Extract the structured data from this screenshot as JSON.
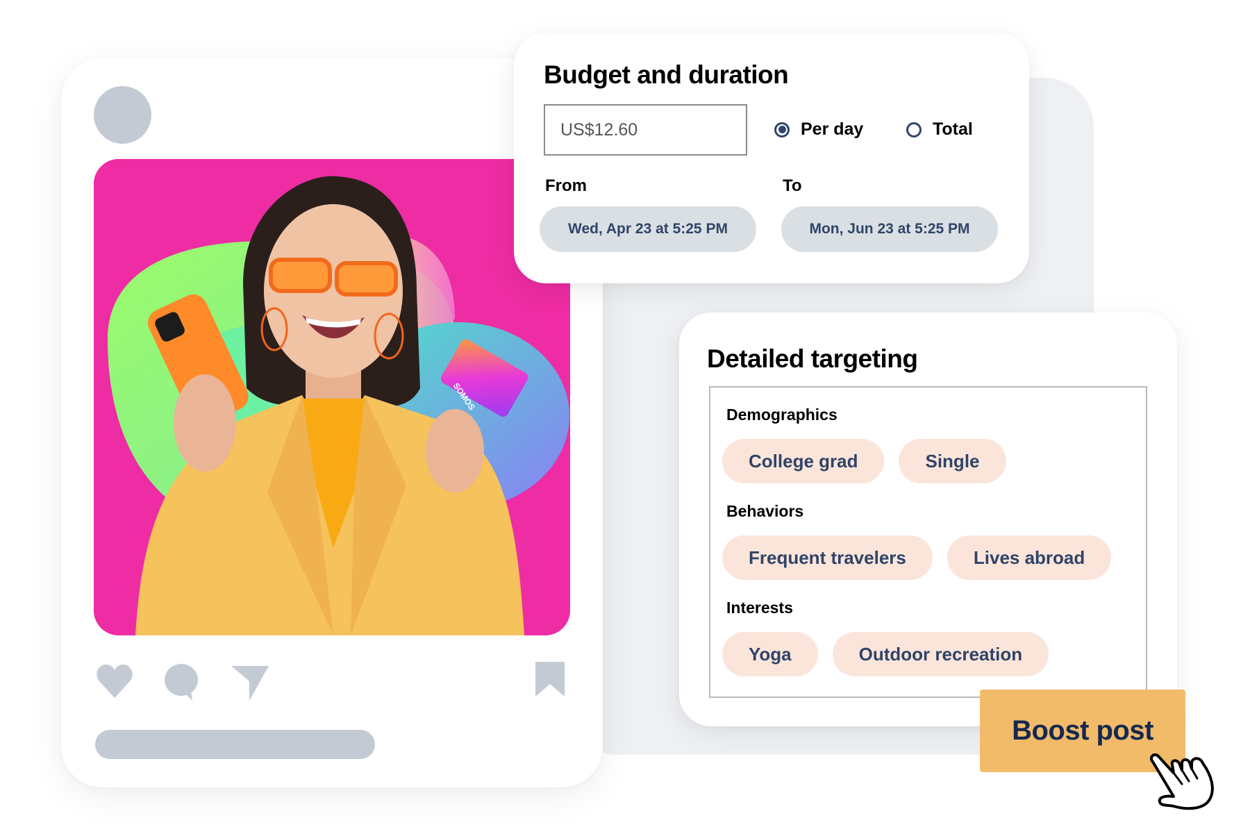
{
  "post": {
    "image_alt": "Smiling woman in orange sunglasses and yellow jacket holding an orange phone and a payment card on a pink background with gradient blobs",
    "card_brand_text": "SOMOS",
    "actions": [
      {
        "name": "like",
        "icon": "heart-icon"
      },
      {
        "name": "comment",
        "icon": "comment-bubble-icon"
      },
      {
        "name": "share",
        "icon": "send-icon"
      },
      {
        "name": "save",
        "icon": "bookmark-icon"
      }
    ]
  },
  "budget": {
    "title": "Budget and duration",
    "amount_value": "US$12.60",
    "options": [
      {
        "label": "Per day",
        "selected": true
      },
      {
        "label": "Total",
        "selected": false
      }
    ],
    "from_label": "From",
    "from_value": "Wed, Apr 23 at 5:25 PM",
    "to_label": "To",
    "to_value": "Mon, Jun 23 at 5:25 PM"
  },
  "targeting": {
    "title": "Detailed targeting",
    "groups": [
      {
        "label": "Demographics",
        "chips": [
          "College grad",
          "Single"
        ]
      },
      {
        "label": "Behaviors",
        "chips": [
          "Frequent travelers",
          "Lives abroad"
        ]
      },
      {
        "label": "Interests",
        "chips": [
          "Yoga",
          "Outdoor recreation"
        ]
      }
    ]
  },
  "boost": {
    "label": "Boost post",
    "cursor_icon": "hand-pointer-icon"
  },
  "colors": {
    "accent_button": "#f2bb69",
    "chip_bg": "#fbe5da",
    "chip_text": "#2f4468",
    "date_pill_bg": "#dadfe4",
    "image_bg": "#ee2ca3",
    "placeholder_gray": "#c4cad3"
  }
}
